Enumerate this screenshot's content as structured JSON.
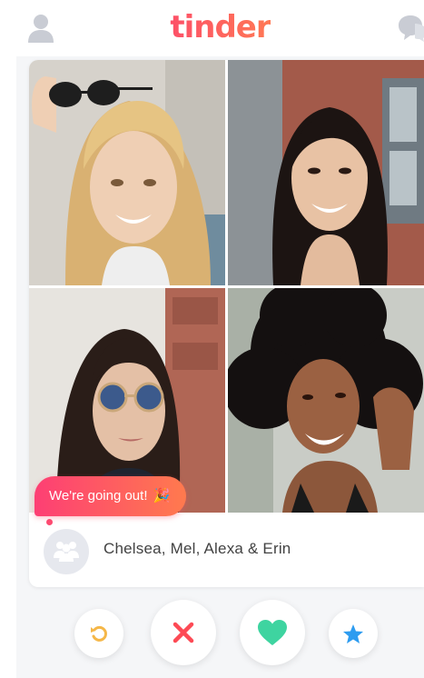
{
  "header": {
    "logo_text": "tinder",
    "profile_icon": "person-icon",
    "chat_icon": "chat-bubbles-icon"
  },
  "card": {
    "photos": [
      {
        "label": "blonde woman with sunglasses"
      },
      {
        "label": "woman with long dark hair"
      },
      {
        "label": "woman with round sunglasses"
      },
      {
        "label": "woman with curly hair"
      }
    ],
    "bubble_text": "We're going out!",
    "bubble_icon": "party-popper-icon",
    "group_icon": "group-people-icon",
    "group_names": "Chelsea, Mel, Alexa & Erin"
  },
  "actions": {
    "rewind_icon": "rewind-icon",
    "nope_icon": "close-icon",
    "like_icon": "heart-icon",
    "superlike_icon": "star-icon"
  },
  "colors": {
    "brand": "#fd5068",
    "rewind": "#f5b748",
    "nope": "#fd4a55",
    "like": "#3ed4a0",
    "superlike": "#2d9cf0"
  }
}
